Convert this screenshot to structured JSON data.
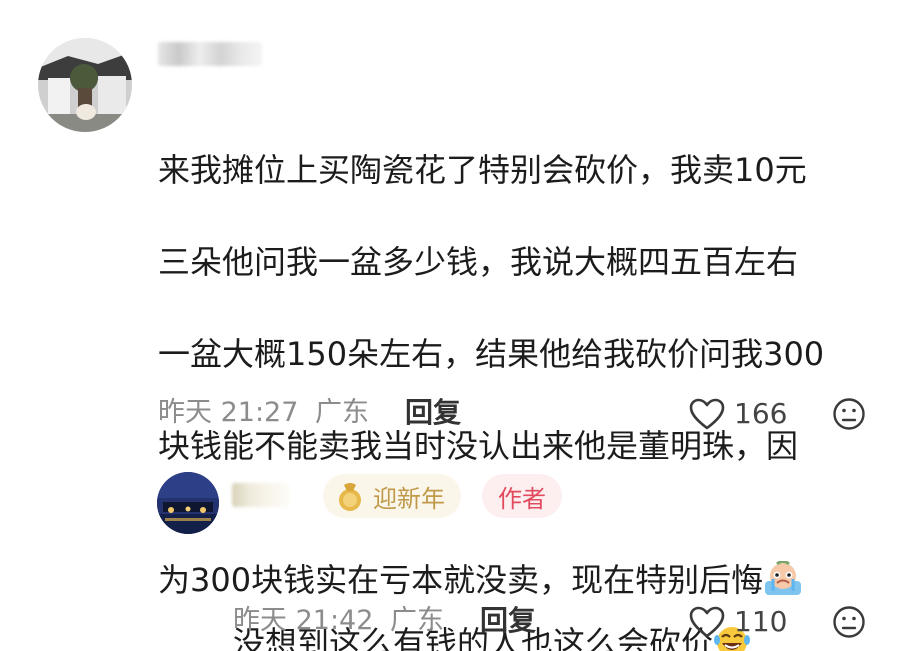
{
  "comments": [
    {
      "text_lines": [
        "来我摊位上买陶瓷花了特别会砍价，我卖10元",
        "三朵他问我一盆多少钱，我说大概四五百左右",
        "一盆大概150朵左右，结果他给我砍价问我300",
        "块钱能不能卖我当时没认出来他是董明珠，因",
        "为300块钱实在亏本就没卖，现在特别后悔"
      ],
      "trailing_emoji": "crying-emoji",
      "time": "昨天 21:27",
      "location": "广东",
      "reply_label": "回复",
      "likes": "166"
    },
    {
      "badges": {
        "newyear": "迎新年",
        "author": "作者"
      },
      "text": "没想到这么有钱的人也这么会砍价",
      "trailing_emoji": "laughing-tears-emoji",
      "time": "昨天 21:42",
      "location": "广东",
      "reply_label": "回复",
      "likes": "110"
    }
  ],
  "colors": {
    "meta_gray": "#8c8c8c",
    "author_badge_text": "#e24a5e",
    "author_badge_bg": "#fdeef0",
    "newyear_badge_text": "#c09a4a",
    "newyear_badge_bg": "#fbf6ea"
  }
}
